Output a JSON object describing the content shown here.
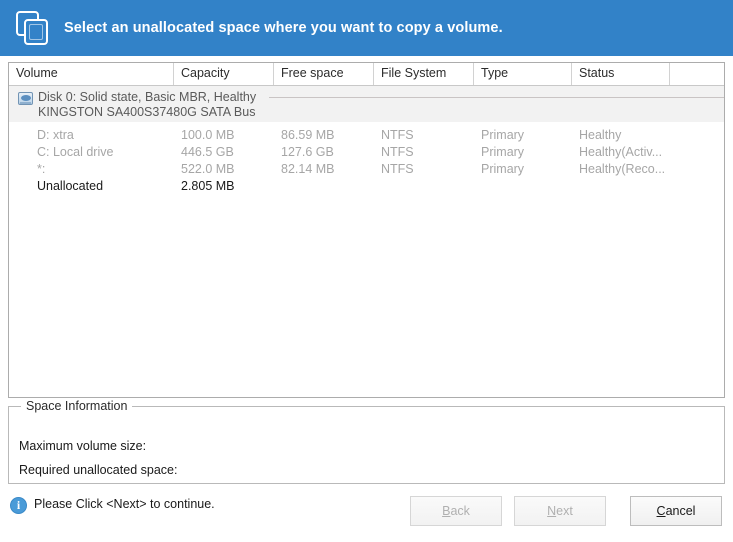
{
  "banner": {
    "icon": "copy-volume-icon",
    "title": "Select an unallocated space where you want to copy a volume.",
    "background": "#3282c8"
  },
  "volume_list": {
    "columns": [
      {
        "key": "volume",
        "label": "Volume"
      },
      {
        "key": "capacity",
        "label": "Capacity"
      },
      {
        "key": "free",
        "label": "Free space"
      },
      {
        "key": "fs",
        "label": "File System"
      },
      {
        "key": "type",
        "label": "Type"
      },
      {
        "key": "status",
        "label": "Status"
      },
      {
        "key": "extra",
        "label": ""
      }
    ],
    "disk_group": {
      "icon": "hard-disk-icon",
      "line1": "Disk 0: Solid state, Basic MBR, Healthy",
      "line2": "KINGSTON SA400S37480G SATA Bus"
    },
    "rows": [
      {
        "volume": "D: xtra",
        "capacity": "100.0 MB",
        "free": "86.59 MB",
        "fs": "NTFS",
        "type": "Primary",
        "status": "Healthy",
        "enabled": false
      },
      {
        "volume": "C: Local drive",
        "capacity": "446.5 GB",
        "free": "127.6 GB",
        "fs": "NTFS",
        "type": "Primary",
        "status": "Healthy(Activ...",
        "enabled": false
      },
      {
        "volume": "*:",
        "capacity": "522.0 MB",
        "free": "82.14 MB",
        "fs": "NTFS",
        "type": "Primary",
        "status": "Healthy(Reco...",
        "enabled": false
      },
      {
        "volume": "Unallocated",
        "capacity": "2.805 MB",
        "free": "",
        "fs": "",
        "type": "",
        "status": "",
        "enabled": true
      }
    ]
  },
  "space_information": {
    "legend": "Space Information",
    "max_volume_size_label": "Maximum volume size:",
    "max_volume_size_value": "",
    "required_unallocated_label": "Required unallocated space:",
    "required_unallocated_value": ""
  },
  "footer": {
    "info_icon": "info-icon",
    "info_glyph": "i",
    "status_text": "Please Click <Next> to continue.",
    "buttons": [
      {
        "id": "back",
        "mnemonic": "B",
        "rest": "ack",
        "enabled": false
      },
      {
        "id": "next",
        "mnemonic": "N",
        "rest": "ext",
        "enabled": false
      },
      {
        "id": "cancel",
        "mnemonic": "C",
        "rest": "ancel",
        "enabled": true
      }
    ]
  }
}
